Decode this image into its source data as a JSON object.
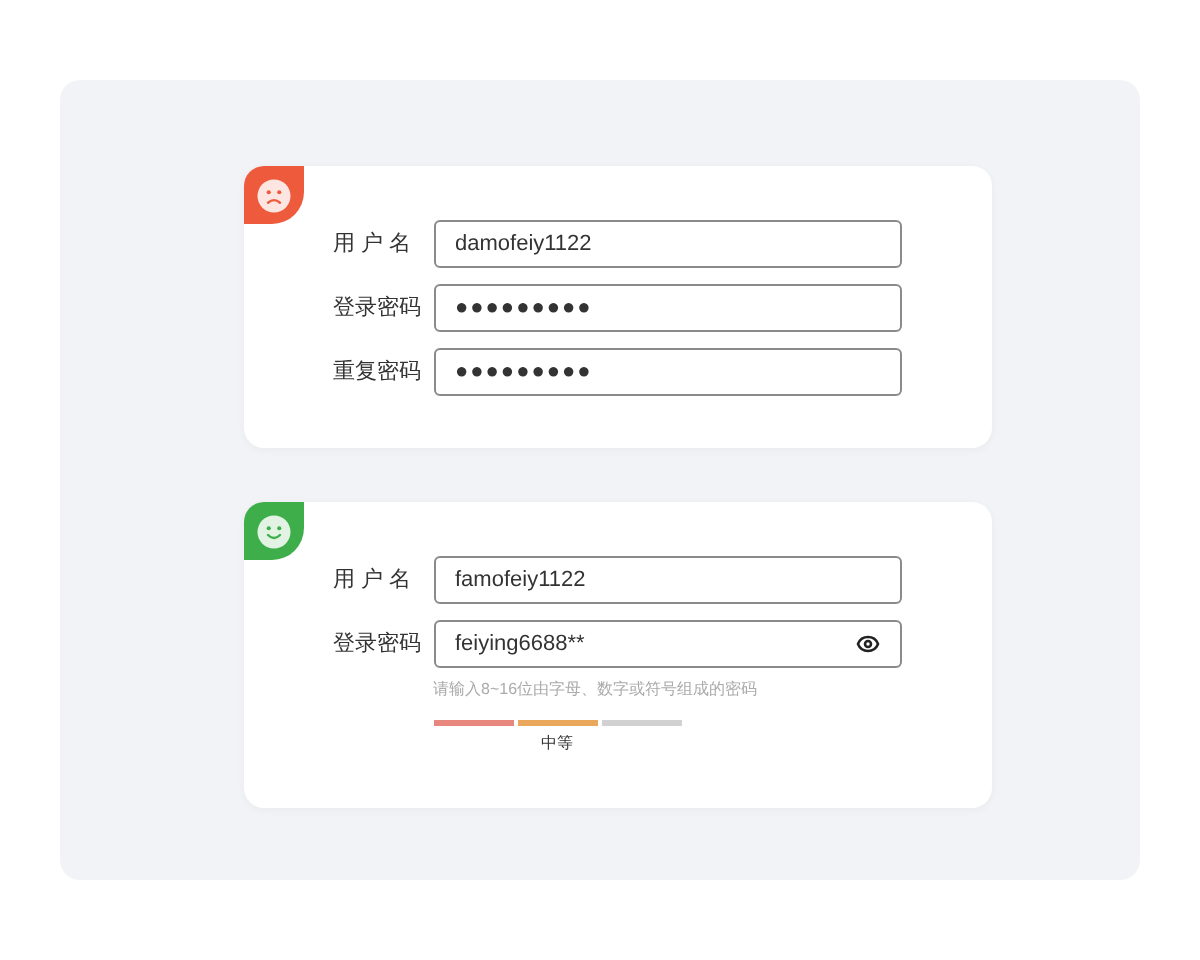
{
  "cards": [
    {
      "kind": "sad",
      "color": "#ee5a3c",
      "fields": [
        {
          "label": "用 户 名",
          "kind": "text",
          "value": "damofeiy1122"
        },
        {
          "label": "登录密码",
          "kind": "masked",
          "value": "●●●●●●●●●"
        },
        {
          "label": "重复密码",
          "kind": "masked",
          "value": "●●●●●●●●●"
        }
      ]
    },
    {
      "kind": "happy",
      "color": "#3dae4a",
      "fields": [
        {
          "label": "用 户 名",
          "kind": "text",
          "value": "famofeiy1122"
        },
        {
          "label": "登录密码",
          "kind": "revealed",
          "value": "feiying6688**",
          "hint": "请输入8~16位由字母、数字或符号组成的密码",
          "strength": {
            "label": "中等",
            "segments": [
              {
                "color": "#e8877d"
              },
              {
                "color": "#e9a85c"
              },
              {
                "color": "#d1d1d1"
              }
            ]
          }
        }
      ]
    }
  ]
}
